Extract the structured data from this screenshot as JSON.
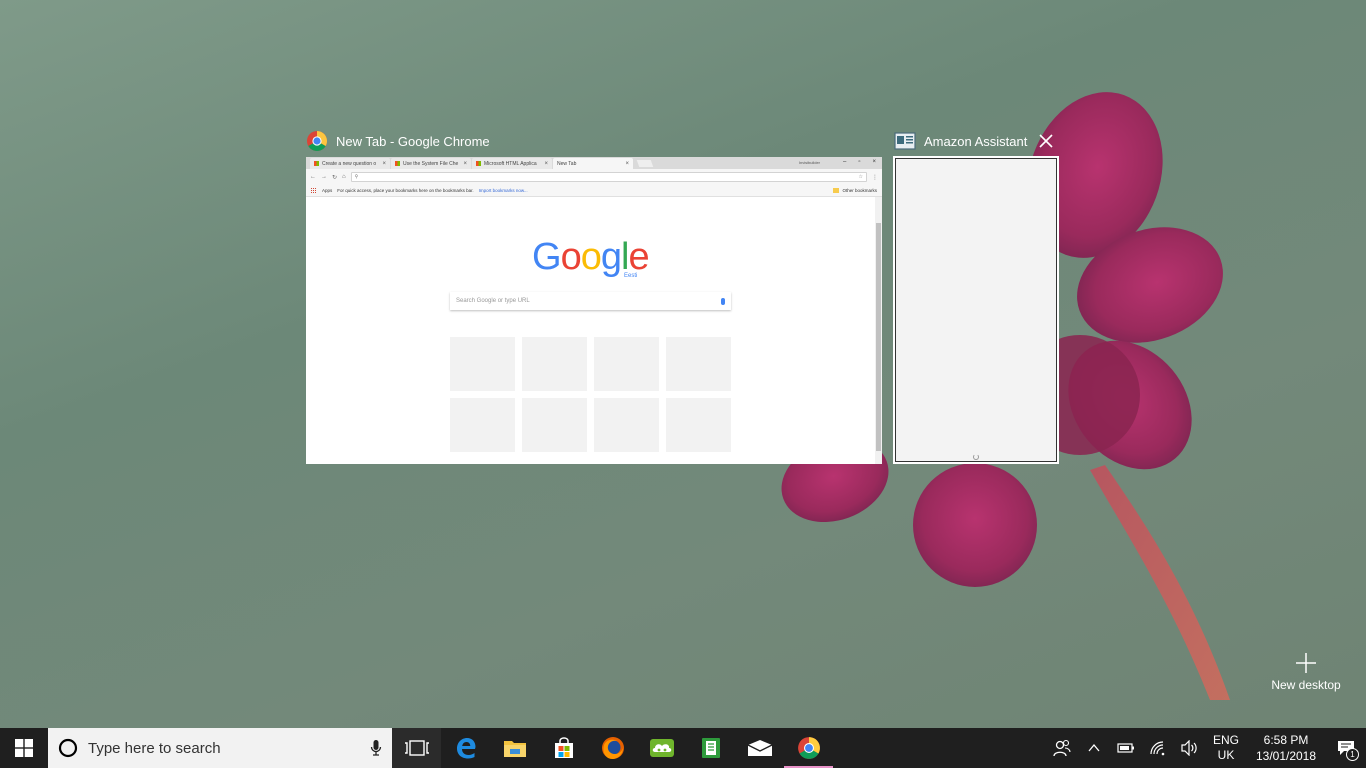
{
  "task_view": {
    "chrome_window": {
      "title": "New Tab - Google Chrome",
      "tabs": [
        {
          "label": "Create a new question o"
        },
        {
          "label": "Use the System File Che"
        },
        {
          "label": "Microsoft HTML Applica"
        },
        {
          "label": "New Tab"
        }
      ],
      "profile_label": "Invisibuilder",
      "bookmarks": {
        "apps_label": "Apps",
        "prompt": "For quick access, place your bookmarks here on the bookmarks bar.",
        "import_link": "Import bookmarks now...",
        "other_label": "Other bookmarks"
      },
      "new_tab_page": {
        "logo": {
          "G": "G",
          "o1": "o",
          "o2": "o",
          "g": "g",
          "l": "l",
          "e": "e"
        },
        "logo_sub": "Eesti",
        "search_placeholder": "Search Google or type URL"
      }
    },
    "amazon_window": {
      "title": "Amazon Assistant"
    },
    "new_desktop_label": "New desktop"
  },
  "taskbar": {
    "search_placeholder": "Type here to search",
    "language": {
      "line1": "ENG",
      "line2": "UK"
    },
    "clock": {
      "time": "6:58 PM",
      "date": "13/01/2018"
    },
    "notification_count": "1",
    "accent_color": "#e892c8"
  }
}
